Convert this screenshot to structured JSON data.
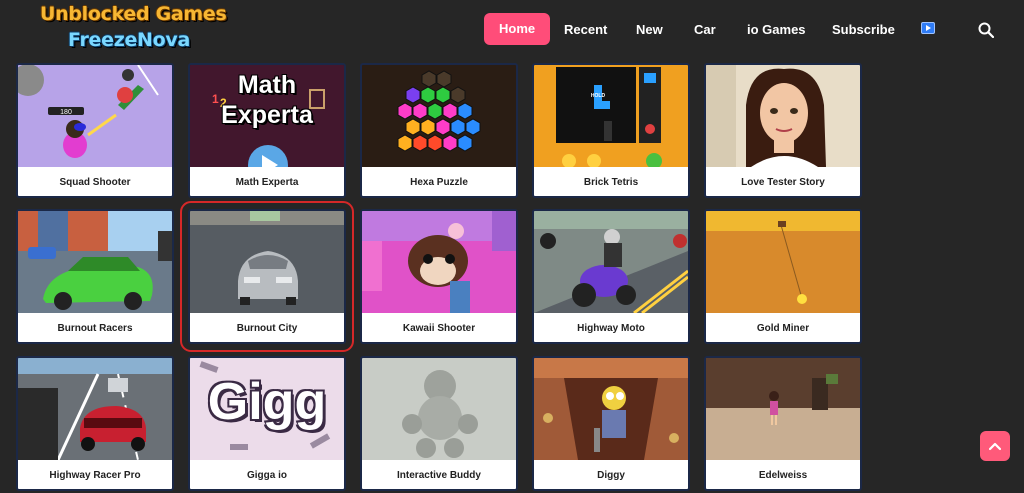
{
  "logo": {
    "line1": "Unblocked Games",
    "line2": "FreezeNova"
  },
  "nav": {
    "home": "Home",
    "recent": "Recent",
    "new": "New",
    "car": "Car",
    "io": "io Games",
    "subscribe": "Subscribe"
  },
  "colors": {
    "accent": "#ff4d79",
    "background": "#262626",
    "card_border": "#1b2847",
    "selected_outline": "#d62828"
  },
  "games": [
    {
      "title": "Squad Shooter"
    },
    {
      "title": "Math Experta",
      "art_text_1": "Math",
      "art_text_2": "Experta"
    },
    {
      "title": "Hexa Puzzle"
    },
    {
      "title": "Brick Tetris",
      "art_text": "HOLD"
    },
    {
      "title": "Love Tester Story"
    },
    {
      "title": "Burnout Racers"
    },
    {
      "title": "Burnout City"
    },
    {
      "title": "Kawaii Shooter"
    },
    {
      "title": "Highway Moto"
    },
    {
      "title": "Gold Miner"
    },
    {
      "title": "Highway Racer Pro"
    },
    {
      "title": "Gigga io",
      "art_text": "Gigg"
    },
    {
      "title": "Interactive Buddy"
    },
    {
      "title": "Diggy"
    },
    {
      "title": "Edelweiss"
    }
  ],
  "icons": {
    "search": "search-icon",
    "scroll_top": "chevron-up-icon",
    "video": "play-icon"
  }
}
